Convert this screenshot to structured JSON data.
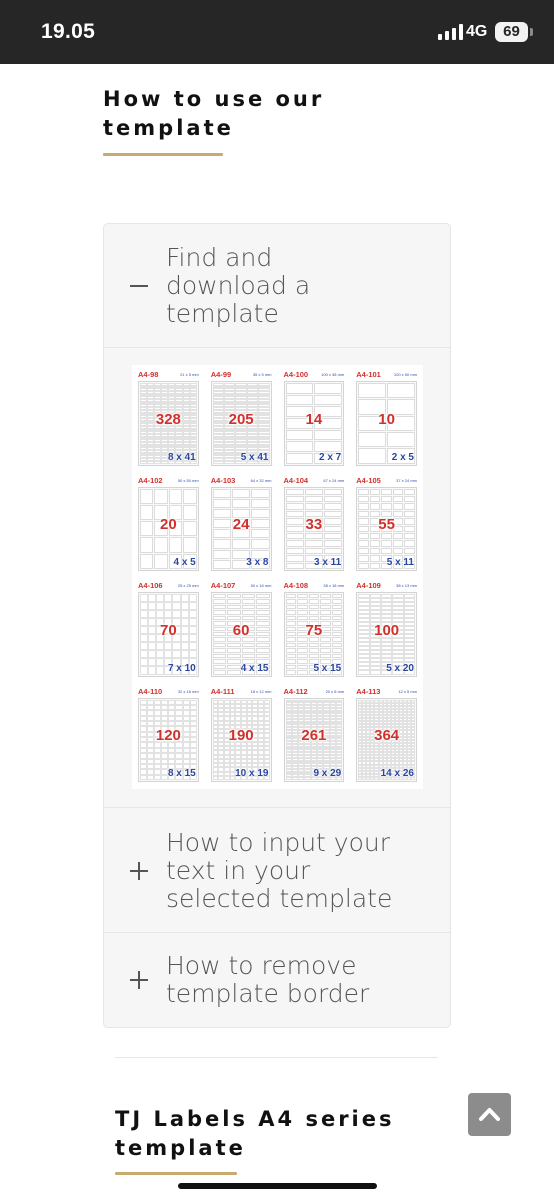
{
  "status_bar": {
    "time": "19.05",
    "network": "4G",
    "battery": "69",
    "signal_icon": "signal-bars-icon"
  },
  "section1": {
    "title_line1": "How to use our",
    "title_line2": "template"
  },
  "accordion": {
    "items": [
      {
        "title_lines": [
          "Find and",
          "download a",
          "template"
        ],
        "expanded": true,
        "icon": "minus-icon"
      },
      {
        "title_lines": [
          "How to input your",
          "text in your",
          "selected template"
        ],
        "expanded": false,
        "icon": "plus-icon"
      },
      {
        "title_lines": [
          "How to remove",
          "template border"
        ],
        "expanded": false,
        "icon": "plus-icon"
      }
    ]
  },
  "templates": [
    {
      "code": "A4-98",
      "size": "21 x 5 mm",
      "count": "328",
      "dims": "8 x 41"
    },
    {
      "code": "A4-99",
      "size": "35 x 5 mm",
      "count": "205",
      "dims": "5 x 41"
    },
    {
      "code": "A4-100",
      "size": "100 x 38 mm",
      "count": "14",
      "dims": "2 x 7"
    },
    {
      "code": "A4-101",
      "size": "100 x 50 mm",
      "count": "10",
      "dims": "2 x 5"
    },
    {
      "code": "A4-102",
      "size": "50 x 50 mm",
      "count": "20",
      "dims": "4 x 5"
    },
    {
      "code": "A4-103",
      "size": "64 x 32 mm",
      "count": "24",
      "dims": "3 x 8"
    },
    {
      "code": "A4-104",
      "size": "67 x 24 mm",
      "count": "33",
      "dims": "3 x 11"
    },
    {
      "code": "A4-105",
      "size": "37 x 24 mm",
      "count": "55",
      "dims": "5 x 11"
    },
    {
      "code": "A4-106",
      "size": "25 x 25 mm",
      "count": "70",
      "dims": "7 x 10"
    },
    {
      "code": "A4-107",
      "size": "50 x 16 mm",
      "count": "60",
      "dims": "4 x 15"
    },
    {
      "code": "A4-108",
      "size": "38 x 18 mm",
      "count": "75",
      "dims": "5 x 15"
    },
    {
      "code": "A4-109",
      "size": "38 x 13 mm",
      "count": "100",
      "dims": "5 x 20"
    },
    {
      "code": "A4-110",
      "size": "32 x 16 mm",
      "count": "120",
      "dims": "8 x 15"
    },
    {
      "code": "A4-111",
      "size": "18 x 12 mm",
      "count": "190",
      "dims": "10 x 19"
    },
    {
      "code": "A4-112",
      "size": "20 x 8 mm",
      "count": "261",
      "dims": "9 x 29"
    },
    {
      "code": "A4-113",
      "size": "12 x 5 mm",
      "count": "364",
      "dims": "14 x 26"
    }
  ],
  "section2": {
    "title_line1": "TJ Labels A4 series",
    "title_line2": "template"
  },
  "scroll_top_icon": "chevron-up-icon",
  "colors": {
    "accent_gold": "#c8aa6e",
    "template_code_red": "#d0312d",
    "template_dims_blue": "#2a47a3",
    "status_bar_bg": "#262626"
  }
}
